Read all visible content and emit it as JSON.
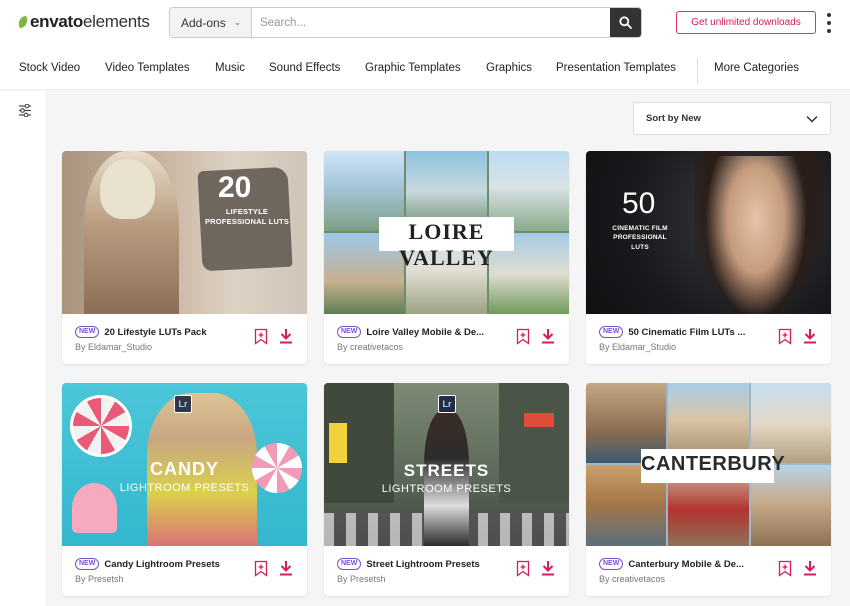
{
  "brand": {
    "logo_bold": "envato",
    "logo_light": "elements"
  },
  "search": {
    "category": "Add-ons",
    "placeholder": "Search..."
  },
  "cta_label": "Get unlimited downloads",
  "nav": [
    "Stock Video",
    "Video Templates",
    "Music",
    "Sound Effects",
    "Graphic Templates",
    "Graphics",
    "Presentation Templates",
    "More Categories"
  ],
  "sort_label": "Sort by New",
  "colors": {
    "accent": "#d21e5a",
    "badge": "#7b4fc9",
    "logo_green": "#82b541"
  },
  "cards": [
    {
      "badge": "NEW",
      "title": "20 Lifestyle LUTs Pack",
      "author": "By Eldamar_Studio",
      "thumb_num": "20",
      "thumb_line1": "LIFESTYLE",
      "thumb_line2": "PROFESSIONAL LUTS"
    },
    {
      "badge": "NEW",
      "title": "Loire Valley Mobile & De...",
      "author": "By creativetacos",
      "thumb_banner": "LOIRE VALLEY"
    },
    {
      "badge": "NEW",
      "title": "50 Cinematic Film LUTs ...",
      "author": "By Eldamar_Studio",
      "thumb_num": "50",
      "thumb_line1": "CINEMATIC FILM",
      "thumb_line2": "PROFESSIONAL LUTS"
    },
    {
      "badge": "NEW",
      "title": "Candy Lightroom Presets",
      "author": "By Presetsh",
      "thumb_badge": "Lr",
      "thumb_big": "CANDY",
      "thumb_sub": "LIGHTROOM PRESETS"
    },
    {
      "badge": "NEW",
      "title": "Street Lightroom Presets",
      "author": "By Presetsh",
      "thumb_badge": "Lr",
      "thumb_big": "STREETS",
      "thumb_sub": "LIGHTROOM PRESETS"
    },
    {
      "badge": "NEW",
      "title": "Canterbury Mobile & De...",
      "author": "By creativetacos",
      "thumb_banner": "CANTERBURY"
    }
  ]
}
